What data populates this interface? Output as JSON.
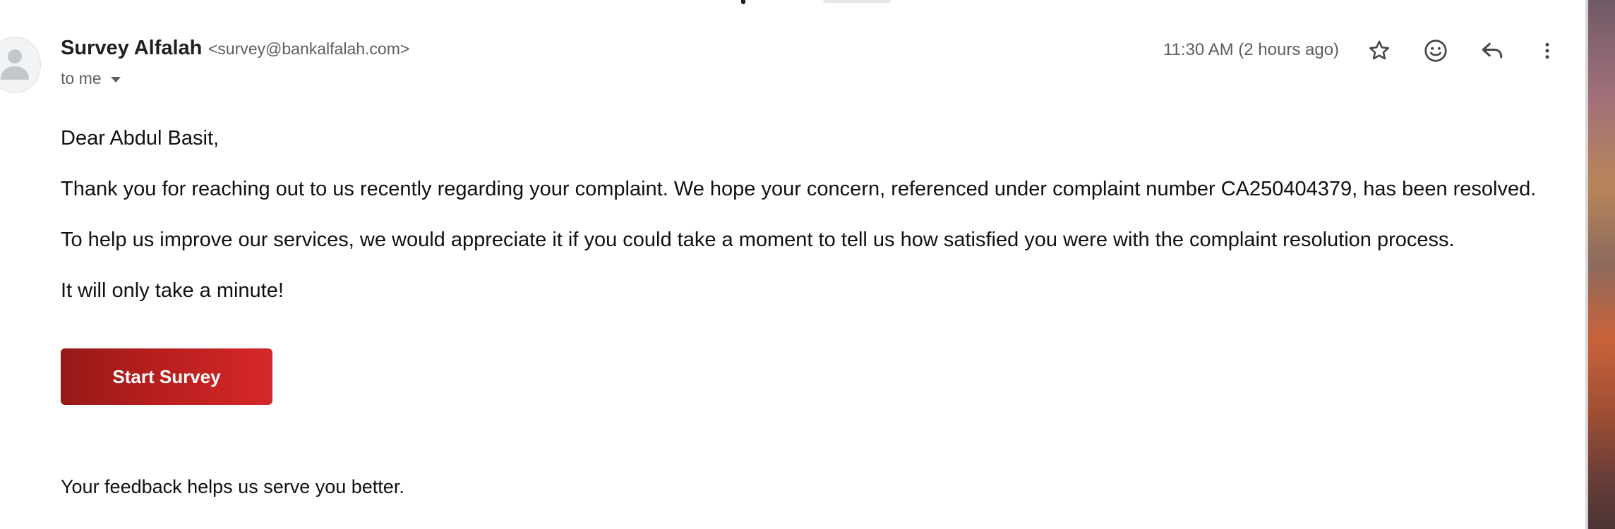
{
  "email": {
    "sender_name": "Survey Alfalah",
    "sender_email": "<survey@bankalfalah.com>",
    "recipient": "to me",
    "timestamp": "11:30 AM (2 hours ago)",
    "body": {
      "greeting": "Dear Abdul Basit,",
      "paragraph_1": "Thank you for reaching out to us recently regarding your complaint. We hope your concern, referenced under complaint number CA250404379, has been resolved.",
      "paragraph_2": "To help us improve our services, we would appreciate it if you could take a moment to tell us how satisfied you were with the complaint resolution process.",
      "paragraph_3": "It will only take a minute!",
      "button_label": "Start Survey",
      "closing": "Your feedback helps us serve you better."
    }
  },
  "icons": {
    "avatar": "person-icon",
    "recipient_caret": "chevron-down-icon",
    "star": "star-icon",
    "emoji": "emoji-icon",
    "reply": "reply-icon",
    "more": "more-vert-icon"
  },
  "colors": {
    "button_gradient_start": "#941a18",
    "button_gradient_end": "#d52828",
    "secondary_text": "#5e5e5e",
    "primary_text": "#1f1f1f"
  }
}
